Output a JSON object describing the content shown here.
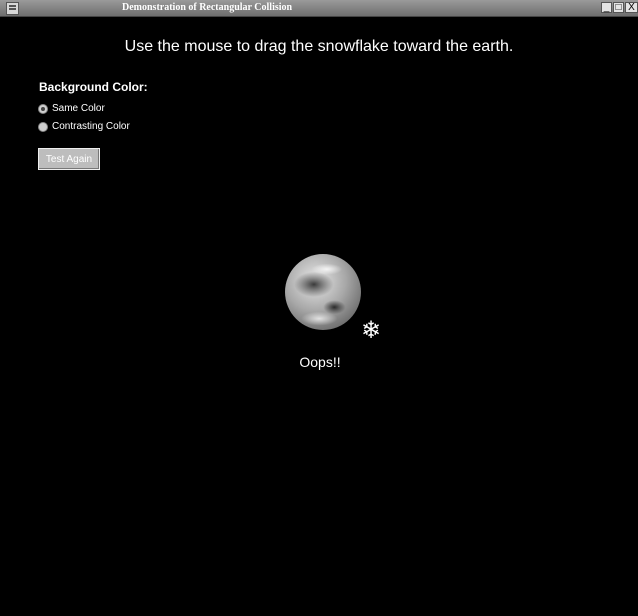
{
  "window": {
    "title": "Demonstration of Rectangular Collision",
    "controls": {
      "minimize": "_",
      "maximize": "□",
      "close": "X"
    }
  },
  "instruction": "Use the mouse to drag the snowflake toward the earth.",
  "background": {
    "label": "Background Color:",
    "options": [
      {
        "label": "Same Color",
        "checked": true
      },
      {
        "label": "Contrasting Color",
        "checked": false
      }
    ]
  },
  "test_button": "Test Again",
  "status": "Oops!!",
  "icons": {
    "snowflake": "❄"
  }
}
